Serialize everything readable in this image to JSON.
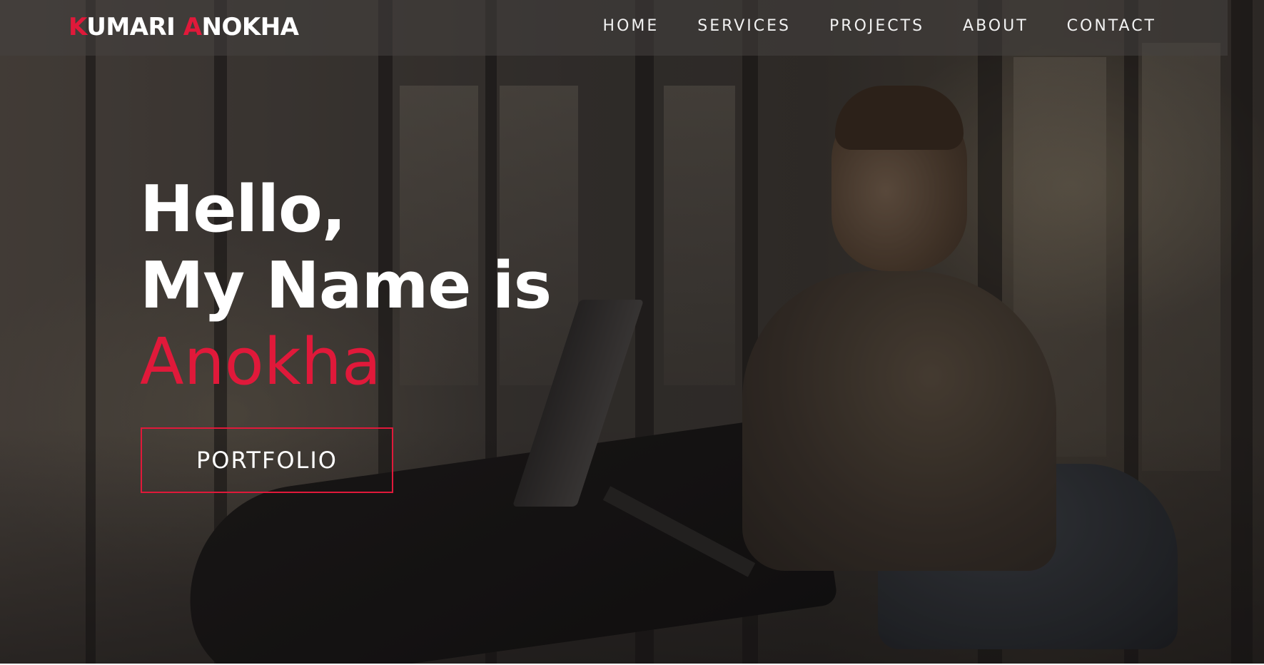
{
  "brand": {
    "initial_first": "K",
    "rest_first": "UMARI ",
    "initial_last": "A",
    "rest_last": "NOKHA",
    "accent_color": "#e0193a"
  },
  "nav": {
    "items": [
      {
        "label": "HOME"
      },
      {
        "label": "SERVICES"
      },
      {
        "label": "PROJECTS"
      },
      {
        "label": "ABOUT"
      },
      {
        "label": "CONTACT"
      }
    ]
  },
  "hero": {
    "line1": "Hello,",
    "line2": "My Name is",
    "name": "Anokha",
    "button_label": "PORTFOLIO",
    "background": "photo-man-with-laptop-and-phone-by-window"
  }
}
